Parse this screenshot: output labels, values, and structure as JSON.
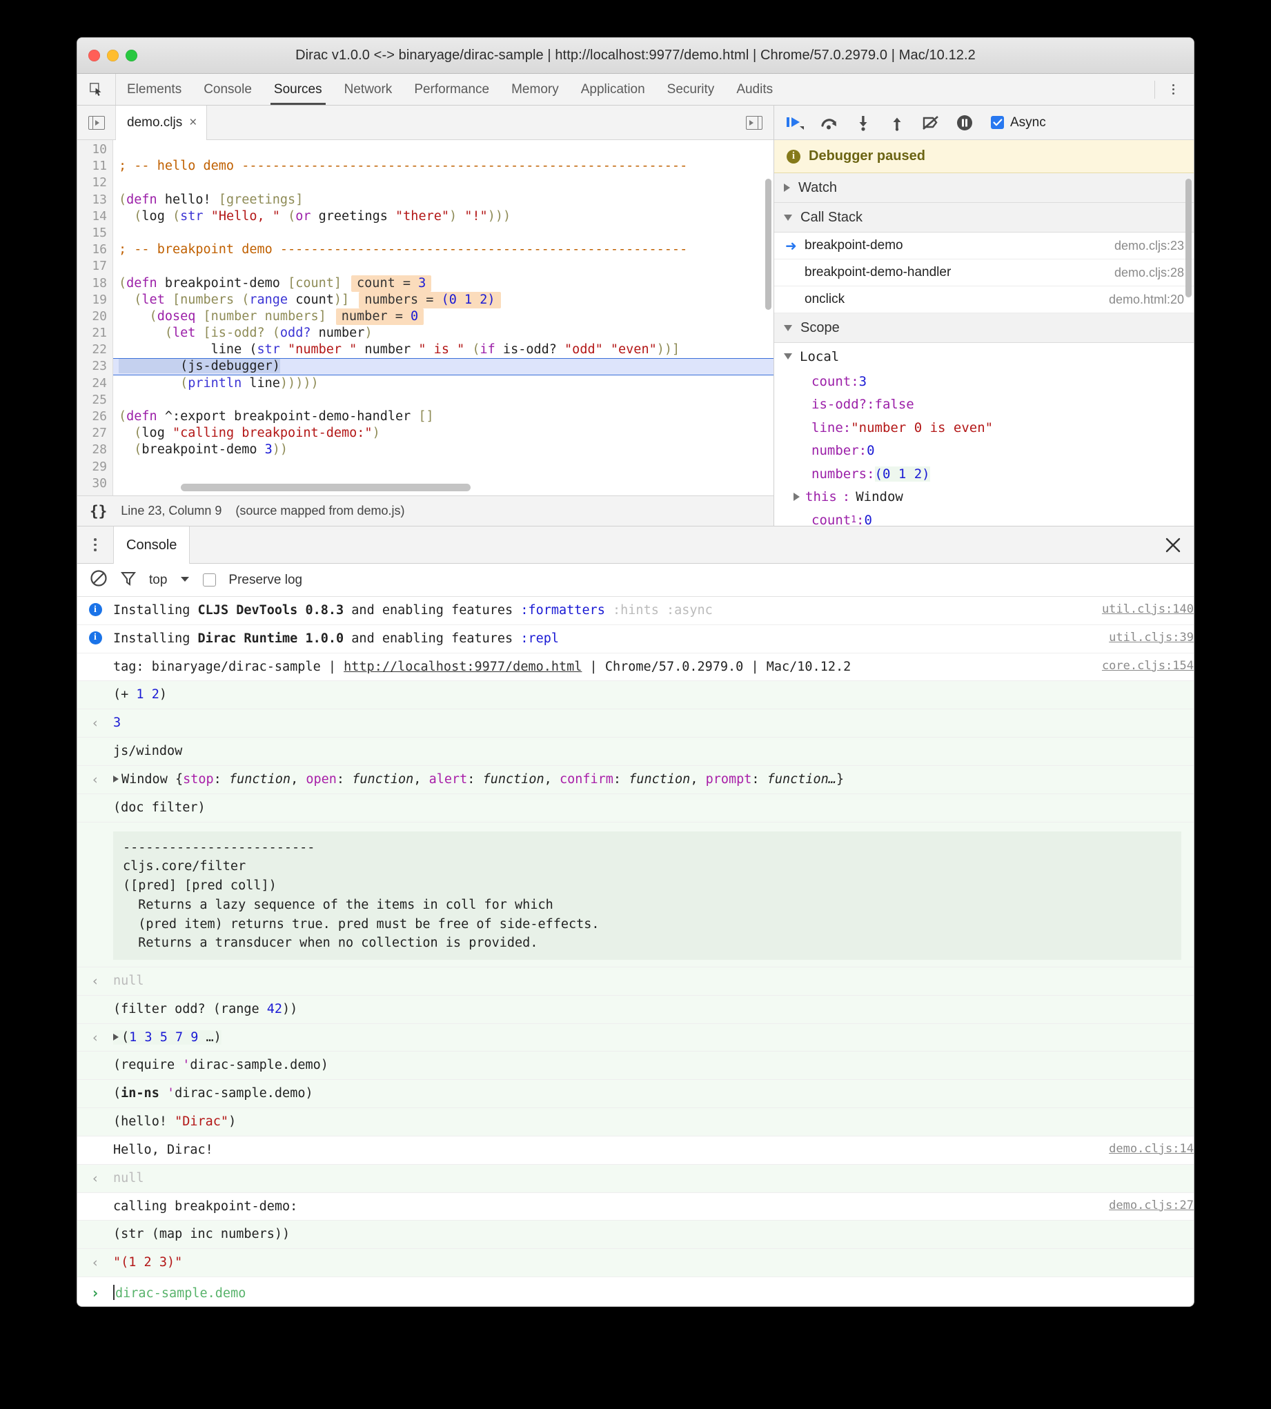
{
  "window": {
    "title": "Dirac v1.0.0 <-> binaryage/dirac-sample | http://localhost:9977/demo.html | Chrome/57.0.2979.0 | Mac/10.12.2"
  },
  "devtools_tabs": [
    {
      "label": "Elements",
      "active": false
    },
    {
      "label": "Console",
      "active": false
    },
    {
      "label": "Sources",
      "active": true
    },
    {
      "label": "Network",
      "active": false
    },
    {
      "label": "Performance",
      "active": false
    },
    {
      "label": "Memory",
      "active": false
    },
    {
      "label": "Application",
      "active": false
    },
    {
      "label": "Security",
      "active": false
    },
    {
      "label": "Audits",
      "active": false
    }
  ],
  "sources": {
    "file_tab": {
      "name": "demo.cljs",
      "close": "×"
    },
    "status": {
      "format_icon": "{}",
      "position": "Line 23, Column 9",
      "note": "(source mapped from demo.js)"
    },
    "first_line_number": 10,
    "lines": [
      {
        "n": 10,
        "blank": true
      },
      {
        "n": 11,
        "segs": [
          {
            "t": "; -- hello demo ----------------------------------------------------------",
            "c": "cmt"
          }
        ]
      },
      {
        "n": 12,
        "blank": true
      },
      {
        "n": 13,
        "segs": [
          {
            "t": "(",
            "c": "paren"
          },
          {
            "t": "defn",
            "c": "kw"
          },
          {
            "t": " hello! ",
            "c": "sym"
          },
          {
            "t": "[greetings]",
            "c": "brk"
          }
        ]
      },
      {
        "n": 14,
        "segs": [
          {
            "t": "  (",
            "c": "paren"
          },
          {
            "t": "log ",
            "c": "sym"
          },
          {
            "t": "(",
            "c": "paren"
          },
          {
            "t": "str",
            "c": "fn"
          },
          {
            "t": " ",
            "c": "sym"
          },
          {
            "t": "\"Hello, \"",
            "c": "str"
          },
          {
            "t": " (",
            "c": "paren"
          },
          {
            "t": "or",
            "c": "kw"
          },
          {
            "t": " greetings ",
            "c": "sym"
          },
          {
            "t": "\"there\"",
            "c": "str"
          },
          {
            "t": ") ",
            "c": "paren"
          },
          {
            "t": "\"!\"",
            "c": "str"
          },
          {
            "t": ")))",
            "c": "paren"
          }
        ]
      },
      {
        "n": 15,
        "blank": true
      },
      {
        "n": 16,
        "segs": [
          {
            "t": "; -- breakpoint demo -----------------------------------------------------",
            "c": "cmt"
          }
        ]
      },
      {
        "n": 17,
        "blank": true
      },
      {
        "n": 18,
        "segs": [
          {
            "t": "(",
            "c": "paren"
          },
          {
            "t": "defn",
            "c": "kw"
          },
          {
            "t": " breakpoint-demo ",
            "c": "sym"
          },
          {
            "t": "[count]",
            "c": "brk"
          }
        ],
        "annotation": {
          "name": "count",
          "value": "3"
        }
      },
      {
        "n": 19,
        "segs": [
          {
            "t": "  (",
            "c": "paren"
          },
          {
            "t": "let",
            "c": "kw"
          },
          {
            "t": " ",
            "c": "sym"
          },
          {
            "t": "[numbers ",
            "c": "brk"
          },
          {
            "t": "(",
            "c": "paren"
          },
          {
            "t": "range",
            "c": "fn"
          },
          {
            "t": " count",
            "c": "sym"
          },
          {
            "t": ")",
            "c": "paren"
          },
          {
            "t": "]",
            "c": "brk"
          }
        ],
        "annotation": {
          "name": "numbers",
          "value": "(0 1 2)"
        }
      },
      {
        "n": 20,
        "segs": [
          {
            "t": "    (",
            "c": "paren"
          },
          {
            "t": "doseq",
            "c": "kw"
          },
          {
            "t": " ",
            "c": "sym"
          },
          {
            "t": "[number numbers]",
            "c": "brk"
          }
        ],
        "annotation": {
          "name": "number",
          "value": "0"
        }
      },
      {
        "n": 21,
        "segs": [
          {
            "t": "      (",
            "c": "paren"
          },
          {
            "t": "let",
            "c": "kw"
          },
          {
            "t": " ",
            "c": "sym"
          },
          {
            "t": "[is-odd? ",
            "c": "brk"
          },
          {
            "t": "(",
            "c": "paren"
          },
          {
            "t": "odd?",
            "c": "fn"
          },
          {
            "t": " number",
            "c": "sym"
          },
          {
            "t": ")",
            "c": "paren"
          }
        ]
      },
      {
        "n": 22,
        "segs": [
          {
            "t": "            line (",
            "c": "sym"
          },
          {
            "t": "str",
            "c": "fn"
          },
          {
            "t": " ",
            "c": "sym"
          },
          {
            "t": "\"number \"",
            "c": "str"
          },
          {
            "t": " number ",
            "c": "sym"
          },
          {
            "t": "\" is \"",
            "c": "str"
          },
          {
            "t": " (",
            "c": "paren"
          },
          {
            "t": "if",
            "c": "kw"
          },
          {
            "t": " is-odd? ",
            "c": "sym"
          },
          {
            "t": "\"odd\"",
            "c": "str"
          },
          {
            "t": " ",
            "c": "sym"
          },
          {
            "t": "\"even\"",
            "c": "str"
          },
          {
            "t": "))]",
            "c": "brk"
          }
        ]
      },
      {
        "n": 23,
        "highlight": true,
        "segs": [
          {
            "t": "        (js-debugger)",
            "c": "selected"
          }
        ]
      },
      {
        "n": 24,
        "segs": [
          {
            "t": "        (",
            "c": "paren"
          },
          {
            "t": "println",
            "c": "fn"
          },
          {
            "t": " line",
            "c": "sym"
          },
          {
            "t": ")))))",
            "c": "paren"
          }
        ]
      },
      {
        "n": 25,
        "blank": true
      },
      {
        "n": 26,
        "segs": [
          {
            "t": "(",
            "c": "paren"
          },
          {
            "t": "defn",
            "c": "kw"
          },
          {
            "t": " ^:export breakpoint-demo-handler ",
            "c": "sym"
          },
          {
            "t": "[]",
            "c": "brk"
          }
        ]
      },
      {
        "n": 27,
        "segs": [
          {
            "t": "  (",
            "c": "paren"
          },
          {
            "t": "log ",
            "c": "sym"
          },
          {
            "t": "\"calling breakpoint-demo:\"",
            "c": "str"
          },
          {
            "t": ")",
            "c": "paren"
          }
        ]
      },
      {
        "n": 28,
        "segs": [
          {
            "t": "  (",
            "c": "paren"
          },
          {
            "t": "breakpoint-demo ",
            "c": "sym"
          },
          {
            "t": "3",
            "c": "num"
          },
          {
            "t": "))",
            "c": "paren"
          }
        ]
      },
      {
        "n": 29,
        "blank": true
      },
      {
        "n": 30,
        "blank": true
      }
    ]
  },
  "debugger": {
    "toolbar": {
      "resume_icon": "resume-script-execution-icon",
      "step_over_icon": "step-over-icon",
      "step_into_icon": "step-into-icon",
      "step_out_icon": "step-out-icon",
      "deactivate_icon": "deactivate-breakpoints-icon",
      "pause_exceptions_icon": "pause-on-exceptions-icon",
      "async_label": "Async",
      "async_checked": true
    },
    "paused_banner": "Debugger paused",
    "watch": {
      "label": "Watch",
      "expanded": false
    },
    "call_stack": {
      "label": "Call Stack",
      "expanded": true,
      "frames": [
        {
          "name": "breakpoint-demo",
          "location": "demo.cljs:23",
          "active": true
        },
        {
          "name": "breakpoint-demo-handler",
          "location": "demo.cljs:28",
          "active": false
        },
        {
          "name": "onclick",
          "location": "demo.html:20",
          "active": false
        }
      ]
    },
    "scope": {
      "label": "Scope",
      "expanded": true,
      "local_label": "Local",
      "vars": [
        {
          "key": "count",
          "value": "3",
          "kind": "num"
        },
        {
          "key": "is-odd?",
          "value": "false",
          "kind": "bool"
        },
        {
          "key": "line",
          "value": "\"number 0 is even\"",
          "kind": "str"
        },
        {
          "key": "number",
          "value": "0",
          "kind": "num"
        },
        {
          "key": "numbers",
          "value": "(0 1 2)",
          "kind": "list"
        },
        {
          "key": "this",
          "value": "Window",
          "kind": "obj",
          "expandable": true
        },
        {
          "key": "count",
          "sub": "1",
          "value": "0",
          "kind": "num"
        }
      ]
    }
  },
  "console": {
    "tab_label": "Console",
    "close_icon": "close-icon",
    "toolbar": {
      "clear_icon": "clear-console-icon",
      "filter_icon": "filter-icon",
      "context": "top",
      "preserve_log": "Preserve log",
      "preserve_log_checked": false
    },
    "entries": [
      {
        "type": "info",
        "bg": "white",
        "source": "util.cljs:140",
        "parts": [
          {
            "t": "Installing ",
            "c": ""
          },
          {
            "t": "CLJS DevTools 0.8.3",
            "c": "b"
          },
          {
            "t": " and enabling features ",
            "c": ""
          },
          {
            "t": ":formatters",
            "c": "kwd"
          },
          {
            "t": " ",
            "c": ""
          },
          {
            "t": ":hints :async",
            "c": "dim"
          }
        ]
      },
      {
        "type": "info",
        "bg": "white",
        "source": "util.cljs:39",
        "parts": [
          {
            "t": "Installing ",
            "c": ""
          },
          {
            "t": "Dirac Runtime 1.0.0",
            "c": "b"
          },
          {
            "t": " and enabling features ",
            "c": ""
          },
          {
            "t": ":repl",
            "c": "kwd"
          }
        ]
      },
      {
        "type": "log",
        "bg": "white",
        "source": "core.cljs:154",
        "parts": [
          {
            "t": "tag: binaryage/dirac-sample | ",
            "c": ""
          },
          {
            "t": "http://localhost:9977/demo.html",
            "c": "link"
          },
          {
            "t": " | Chrome/57.0.2979.0 | Mac/10.12.2",
            "c": ""
          }
        ]
      },
      {
        "type": "input",
        "bg": "green",
        "parts": [
          {
            "t": "(+ ",
            "c": ""
          },
          {
            "t": "1",
            "c": "num2"
          },
          {
            "t": " ",
            "c": ""
          },
          {
            "t": "2",
            "c": "num2"
          },
          {
            "t": ")",
            "c": ""
          }
        ]
      },
      {
        "type": "result",
        "bg": "green",
        "parts": [
          {
            "t": "3",
            "c": "num2"
          }
        ]
      },
      {
        "type": "input",
        "bg": "green",
        "parts": [
          {
            "t": "js/window",
            "c": ""
          }
        ]
      },
      {
        "type": "result",
        "bg": "green",
        "expandable": true,
        "parts": [
          {
            "t": "Window {",
            "c": ""
          },
          {
            "t": "stop",
            "c": "mag"
          },
          {
            "t": ": ",
            "c": ""
          },
          {
            "t": "function",
            "c": "ital"
          },
          {
            "t": ", ",
            "c": ""
          },
          {
            "t": "open",
            "c": "mag"
          },
          {
            "t": ": ",
            "c": ""
          },
          {
            "t": "function",
            "c": "ital"
          },
          {
            "t": ", ",
            "c": ""
          },
          {
            "t": "alert",
            "c": "mag"
          },
          {
            "t": ": ",
            "c": ""
          },
          {
            "t": "function",
            "c": "ital"
          },
          {
            "t": ", ",
            "c": ""
          },
          {
            "t": "confirm",
            "c": "mag"
          },
          {
            "t": ": ",
            "c": ""
          },
          {
            "t": "function",
            "c": "ital"
          },
          {
            "t": ", ",
            "c": ""
          },
          {
            "t": "prompt",
            "c": "mag"
          },
          {
            "t": ": ",
            "c": ""
          },
          {
            "t": "function…",
            "c": "ital"
          },
          {
            "t": "}",
            "c": ""
          }
        ]
      },
      {
        "type": "input",
        "bg": "green",
        "parts": [
          {
            "t": "(doc filter)",
            "c": ""
          }
        ]
      },
      {
        "type": "docblock",
        "bg": "green",
        "text": "-------------------------\ncljs.core/filter\n([pred] [pred coll])\n  Returns a lazy sequence of the items in coll for which\n  (pred item) returns true. pred must be free of side-effects.\n  Returns a transducer when no collection is provided."
      },
      {
        "type": "result",
        "bg": "green",
        "parts": [
          {
            "t": "null",
            "c": "dim"
          }
        ]
      },
      {
        "type": "input",
        "bg": "green",
        "parts": [
          {
            "t": "(filter odd? (range ",
            "c": ""
          },
          {
            "t": "42",
            "c": "num2"
          },
          {
            "t": "))",
            "c": ""
          }
        ]
      },
      {
        "type": "result",
        "bg": "green",
        "expandable": true,
        "highlight_list": true,
        "parts": [
          {
            "t": "(",
            "c": ""
          },
          {
            "t": "1",
            "c": "num2"
          },
          {
            "t": " ",
            "c": ""
          },
          {
            "t": "3",
            "c": "num2"
          },
          {
            "t": " ",
            "c": ""
          },
          {
            "t": "5",
            "c": "num2"
          },
          {
            "t": " ",
            "c": ""
          },
          {
            "t": "7",
            "c": "num2"
          },
          {
            "t": " ",
            "c": ""
          },
          {
            "t": "9",
            "c": "num2"
          },
          {
            "t": " …)",
            "c": ""
          }
        ]
      },
      {
        "type": "input",
        "bg": "green",
        "parts": [
          {
            "t": "(require ",
            "c": ""
          },
          {
            "t": "'",
            "c": "mag"
          },
          {
            "t": "dirac-sample.demo)",
            "c": ""
          }
        ]
      },
      {
        "type": "input",
        "bg": "green",
        "parts": [
          {
            "t": "(",
            "c": ""
          },
          {
            "t": "in-ns",
            "c": "b"
          },
          {
            "t": " ",
            "c": ""
          },
          {
            "t": "'",
            "c": "mag"
          },
          {
            "t": "dirac-sample.demo)",
            "c": ""
          }
        ]
      },
      {
        "type": "input",
        "bg": "green",
        "parts": [
          {
            "t": "(hello! ",
            "c": ""
          },
          {
            "t": "\"Dirac\"",
            "c": "str2"
          },
          {
            "t": ")",
            "c": ""
          }
        ]
      },
      {
        "type": "log",
        "bg": "white",
        "source": "demo.cljs:14",
        "parts": [
          {
            "t": "Hello, Dirac!",
            "c": ""
          }
        ]
      },
      {
        "type": "result",
        "bg": "green",
        "parts": [
          {
            "t": "null",
            "c": "dim"
          }
        ]
      },
      {
        "type": "log",
        "bg": "white",
        "source": "demo.cljs:27",
        "parts": [
          {
            "t": "calling breakpoint-demo:",
            "c": ""
          }
        ]
      },
      {
        "type": "input",
        "bg": "green",
        "parts": [
          {
            "t": "(str (map inc numbers))",
            "c": ""
          }
        ]
      },
      {
        "type": "result",
        "bg": "green",
        "parts": [
          {
            "t": "\"(1 2 3)\"",
            "c": "str2"
          }
        ]
      }
    ],
    "prompt": {
      "caret": "›",
      "namespace": "dirac-sample.demo"
    }
  }
}
